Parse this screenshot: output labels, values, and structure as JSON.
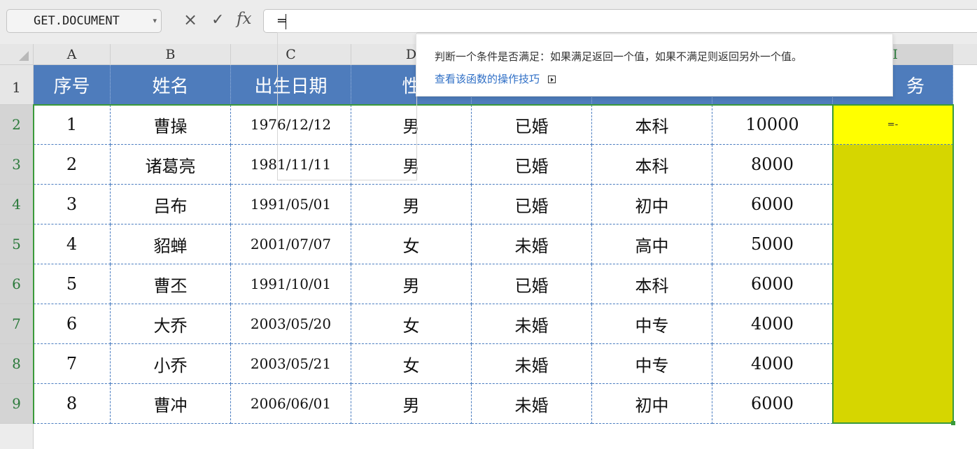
{
  "formula_bar": {
    "name_box": "GET.DOCUMENT",
    "cancel_glyph": "×",
    "enter_glyph": "✓",
    "fx_label": "fx",
    "formula_text": "="
  },
  "columns": [
    "A",
    "B",
    "C",
    "D",
    "",
    "",
    "",
    "I"
  ],
  "rows": [
    "1",
    "2",
    "3",
    "4",
    "5",
    "6",
    "7",
    "8",
    "9"
  ],
  "active_cell": "I2",
  "table": {
    "header": [
      "序号",
      "姓名",
      "出生日期",
      "性",
      "",
      "",
      "",
      "务"
    ],
    "data": [
      [
        "1",
        "曹操",
        "1976/12/12",
        "男",
        "已婚",
        "本科",
        "10000",
        "=-"
      ],
      [
        "2",
        "诸葛亮",
        "1981/11/11",
        "男",
        "已婚",
        "本科",
        "8000",
        ""
      ],
      [
        "3",
        "吕布",
        "1991/05/01",
        "男",
        "已婚",
        "初中",
        "6000",
        ""
      ],
      [
        "4",
        "貂蝉",
        "2001/07/07",
        "女",
        "未婚",
        "高中",
        "5000",
        ""
      ],
      [
        "5",
        "曹丕",
        "1991/10/01",
        "男",
        "已婚",
        "本科",
        "6000",
        ""
      ],
      [
        "6",
        "大乔",
        "2003/05/20",
        "女",
        "未婚",
        "中专",
        "4000",
        ""
      ],
      [
        "7",
        "小乔",
        "2003/05/21",
        "女",
        "未婚",
        "中专",
        "4000",
        ""
      ],
      [
        "8",
        "曹冲",
        "2006/06/01",
        "男",
        "未婚",
        "初中",
        "6000",
        ""
      ]
    ]
  },
  "tooltip": {
    "description": "判断一个条件是否满足：如果满足返回一个值，如果不满足则返回另外一个值。",
    "link": "查看该函数的操作技巧"
  },
  "colors": {
    "header_fill": "#4e7cbc",
    "active_cell_fill": "#ffff00",
    "range_fill": "#d6d600",
    "selection_border": "#3a9a3a",
    "link": "#2f6fc6"
  }
}
